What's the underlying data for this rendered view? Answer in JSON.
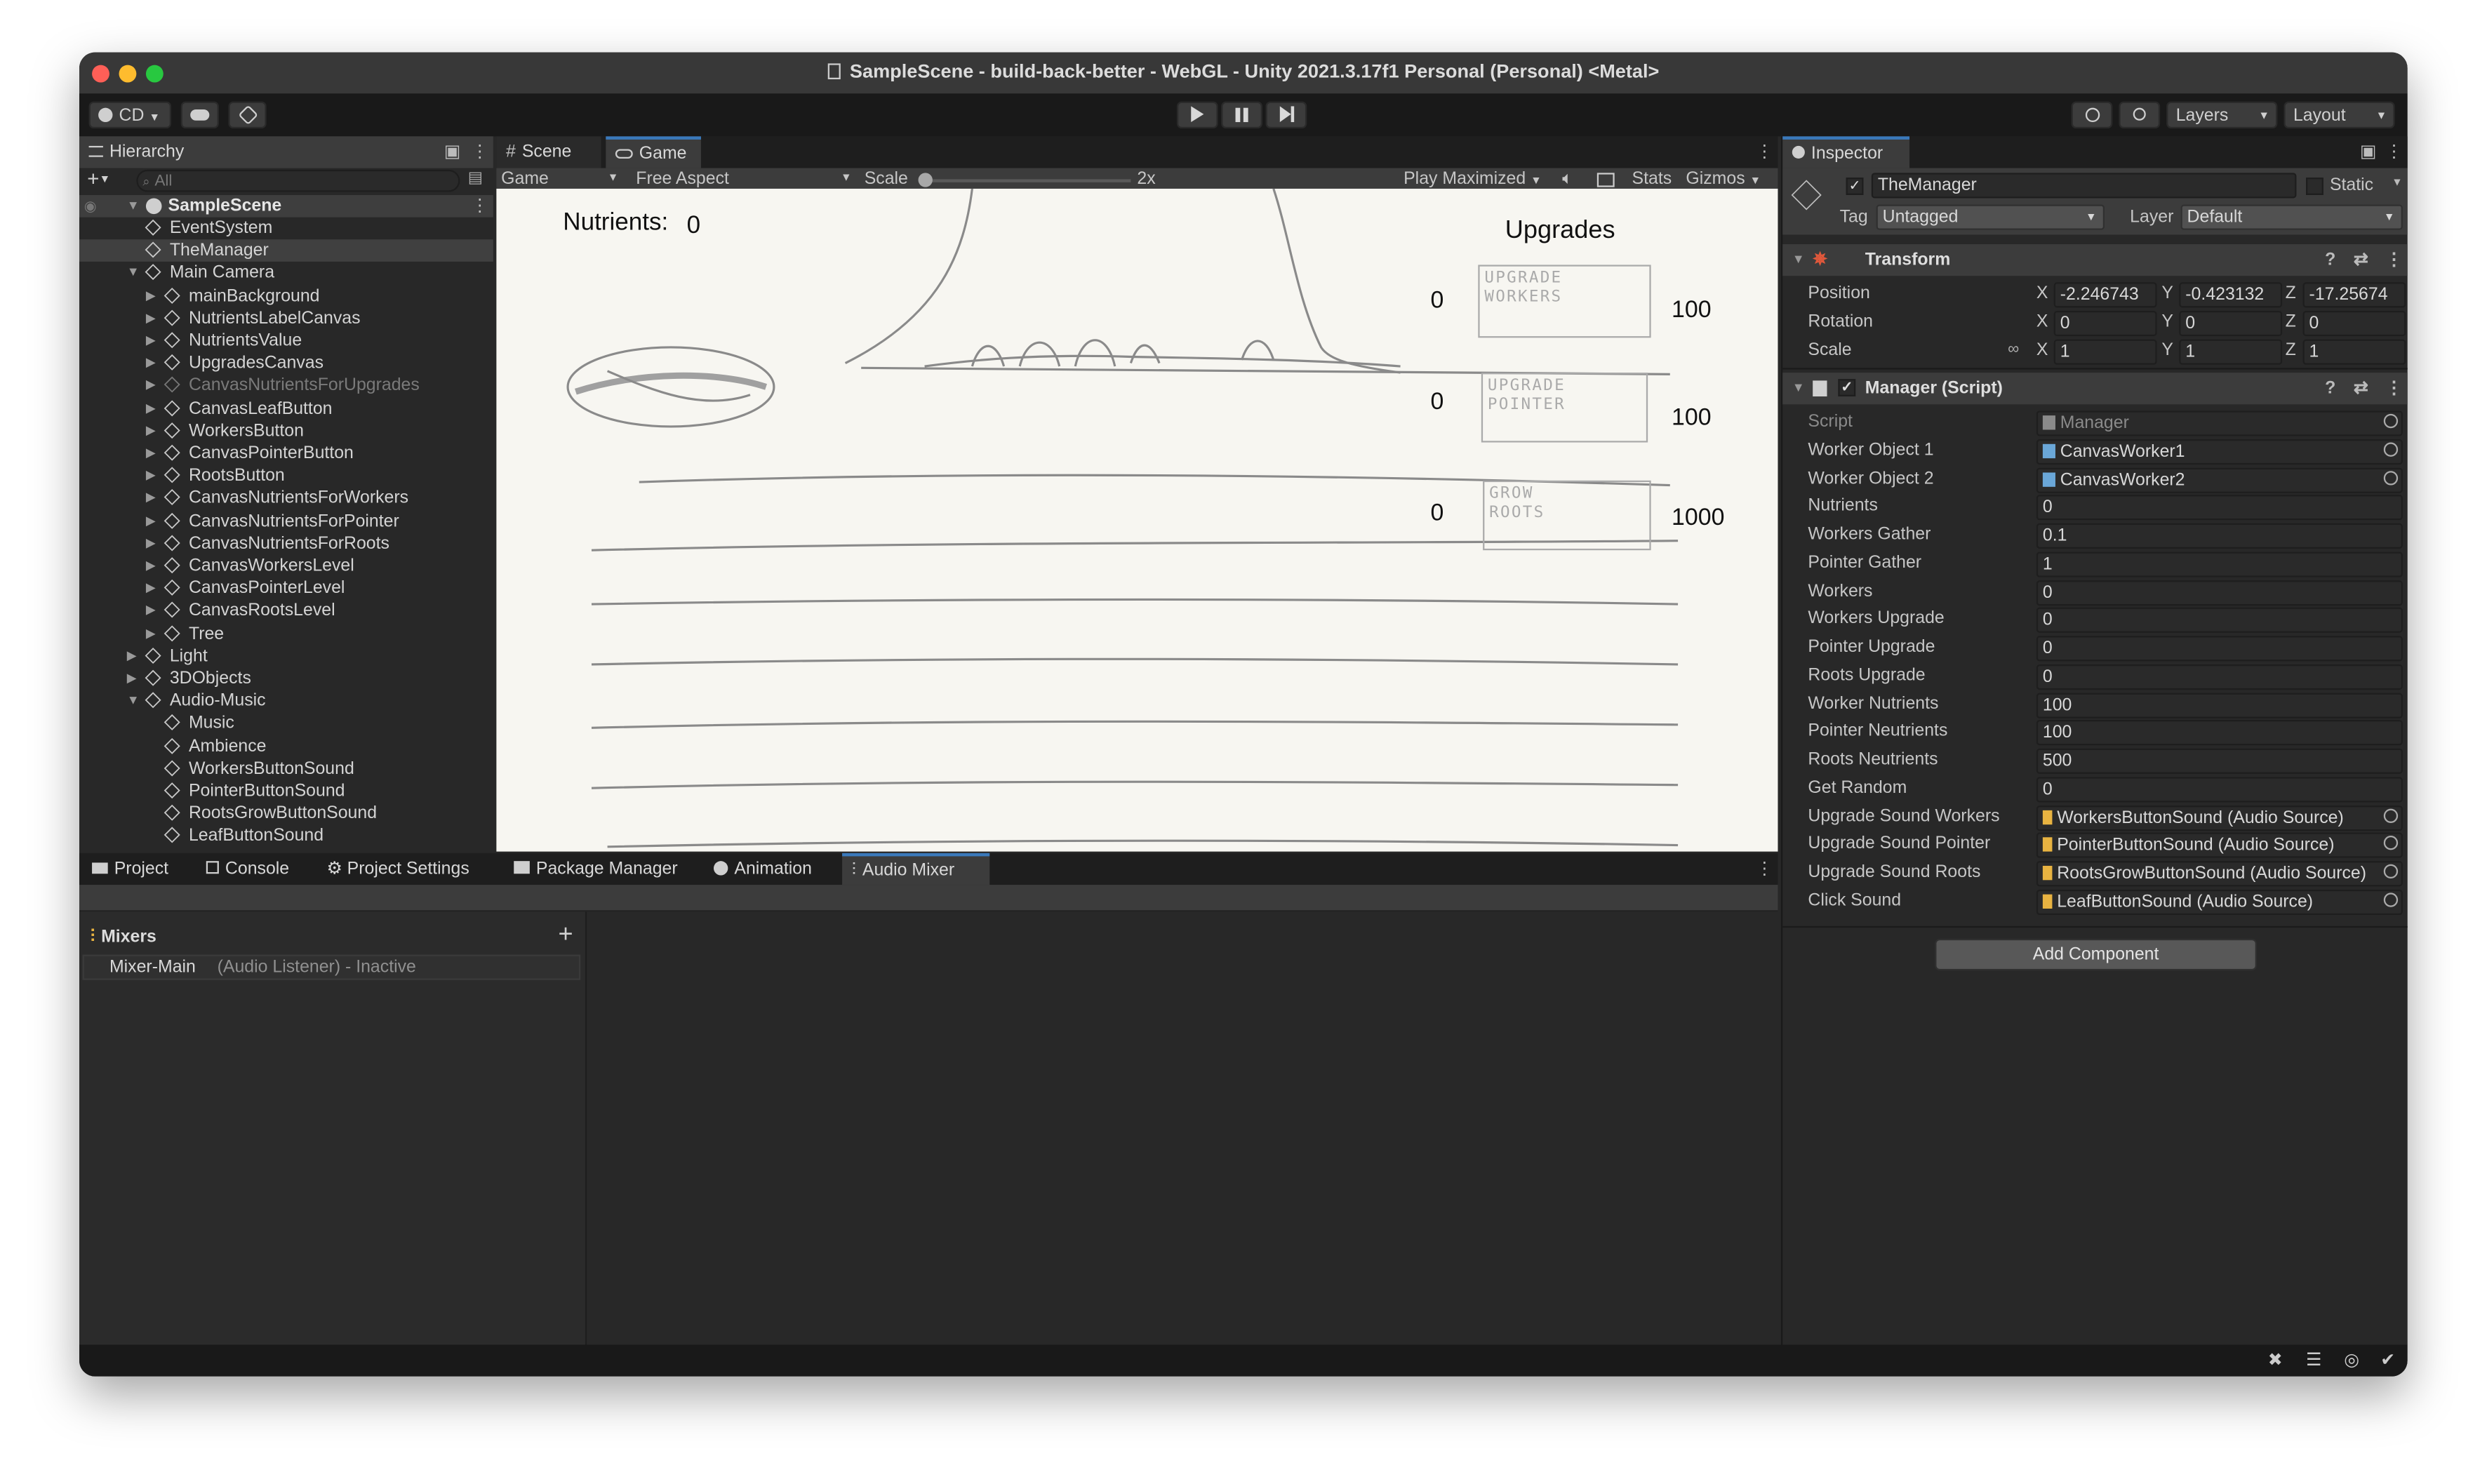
{
  "window": {
    "title": "SampleScene - build-back-better - WebGL - Unity 2021.3.17f1 Personal (Personal) <Metal>"
  },
  "toolbar": {
    "account": "CD",
    "layers": "Layers",
    "layout": "Layout"
  },
  "hierarchy": {
    "tab": "Hierarchy",
    "search_placeholder": "All",
    "scene": "SampleScene",
    "items": [
      {
        "label": "EventSystem",
        "depth": 1,
        "arrow": "",
        "dim": false,
        "selected": false
      },
      {
        "label": "TheManager",
        "depth": 1,
        "arrow": "",
        "dim": false,
        "selected": true
      },
      {
        "label": "Main Camera",
        "depth": 1,
        "arrow": "▼",
        "dim": false,
        "selected": false
      },
      {
        "label": "mainBackground",
        "depth": 2,
        "arrow": "▶",
        "dim": false,
        "selected": false
      },
      {
        "label": "NutrientsLabelCanvas",
        "depth": 2,
        "arrow": "▶",
        "dim": false,
        "selected": false
      },
      {
        "label": "NutrientsValue",
        "depth": 2,
        "arrow": "▶",
        "dim": false,
        "selected": false
      },
      {
        "label": "UpgradesCanvas",
        "depth": 2,
        "arrow": "▶",
        "dim": false,
        "selected": false
      },
      {
        "label": "CanvasNutrientsForUpgrades",
        "depth": 2,
        "arrow": "▶",
        "dim": true,
        "selected": false
      },
      {
        "label": "CanvasLeafButton",
        "depth": 2,
        "arrow": "▶",
        "dim": false,
        "selected": false
      },
      {
        "label": "WorkersButton",
        "depth": 2,
        "arrow": "▶",
        "dim": false,
        "selected": false
      },
      {
        "label": "CanvasPointerButton",
        "depth": 2,
        "arrow": "▶",
        "dim": false,
        "selected": false
      },
      {
        "label": "RootsButton",
        "depth": 2,
        "arrow": "▶",
        "dim": false,
        "selected": false
      },
      {
        "label": "CanvasNutrientsForWorkers",
        "depth": 2,
        "arrow": "▶",
        "dim": false,
        "selected": false
      },
      {
        "label": "CanvasNutrientsForPointer",
        "depth": 2,
        "arrow": "▶",
        "dim": false,
        "selected": false
      },
      {
        "label": "CanvasNutrientsForRoots",
        "depth": 2,
        "arrow": "▶",
        "dim": false,
        "selected": false
      },
      {
        "label": "CanvasWorkersLevel",
        "depth": 2,
        "arrow": "▶",
        "dim": false,
        "selected": false
      },
      {
        "label": "CanvasPointerLevel",
        "depth": 2,
        "arrow": "▶",
        "dim": false,
        "selected": false
      },
      {
        "label": "CanvasRootsLevel",
        "depth": 2,
        "arrow": "▶",
        "dim": false,
        "selected": false
      },
      {
        "label": "Tree",
        "depth": 2,
        "arrow": "▶",
        "dim": false,
        "selected": false
      },
      {
        "label": "Light",
        "depth": 1,
        "arrow": "▶",
        "dim": false,
        "selected": false
      },
      {
        "label": "3DObjects",
        "depth": 1,
        "arrow": "▶",
        "dim": false,
        "selected": false
      },
      {
        "label": "Audio-Music",
        "depth": 1,
        "arrow": "▼",
        "dim": false,
        "selected": false
      },
      {
        "label": "Music",
        "depth": 2,
        "arrow": "",
        "dim": false,
        "selected": false
      },
      {
        "label": "Ambience",
        "depth": 2,
        "arrow": "",
        "dim": false,
        "selected": false
      },
      {
        "label": "WorkersButtonSound",
        "depth": 2,
        "arrow": "",
        "dim": false,
        "selected": false
      },
      {
        "label": "PointerButtonSound",
        "depth": 2,
        "arrow": "",
        "dim": false,
        "selected": false
      },
      {
        "label": "RootsGrowButtonSound",
        "depth": 2,
        "arrow": "",
        "dim": false,
        "selected": false
      },
      {
        "label": "LeafButtonSound",
        "depth": 2,
        "arrow": "",
        "dim": false,
        "selected": false
      }
    ]
  },
  "center": {
    "tabs": [
      "Scene",
      "Game"
    ],
    "display": "Game",
    "aspect": "Free Aspect",
    "scale_label": "Scale",
    "scale_value": "2x",
    "play_maximized": "Play Maximized",
    "stats": "Stats",
    "gizmos": "Gizmos"
  },
  "game": {
    "nutrients_label": "Nutrients:",
    "nutrients_value": "0",
    "upgrades_title": "Upgrades",
    "upgrades": [
      {
        "level": "0",
        "sketch": "UPGRADE\nWORKERS",
        "cost": "100"
      },
      {
        "level": "0",
        "sketch": "UPGRADE\nPOINTER",
        "cost": "100"
      },
      {
        "level": "0",
        "sketch": "GROW\nROOTS",
        "cost": "1000"
      }
    ]
  },
  "bottom": {
    "tabs": [
      "Project",
      "Console",
      "Project Settings",
      "Package Manager",
      "Animation",
      "Audio Mixer"
    ],
    "mixers_title": "Mixers",
    "mixer_name": "Mixer-Main",
    "mixer_status": "(Audio Listener) - Inactive"
  },
  "inspector": {
    "tab": "Inspector",
    "object_name": "TheManager",
    "static_label": "Static",
    "tag_label": "Tag",
    "tag_value": "Untagged",
    "layer_label": "Layer",
    "layer_value": "Default",
    "transform": {
      "title": "Transform",
      "rows": [
        {
          "label": "Position",
          "x": "-2.246743",
          "y": "-0.423132 ",
          "z": "-17.25674"
        },
        {
          "label": "Rotation",
          "x": "0",
          "y": "0",
          "z": "0"
        },
        {
          "label": "Scale",
          "x": "1",
          "y": "1",
          "z": "1"
        }
      ]
    },
    "script": {
      "title": "Manager (Script)",
      "fields": [
        {
          "label": "Script",
          "value": "Manager",
          "kind": "script"
        },
        {
          "label": "Worker Object 1",
          "value": "CanvasWorker1",
          "kind": "object"
        },
        {
          "label": "Worker Object 2",
          "value": "CanvasWorker2",
          "kind": "object"
        },
        {
          "label": "Nutrients",
          "value": "0",
          "kind": "value"
        },
        {
          "label": "Workers Gather",
          "value": "0.1",
          "kind": "value"
        },
        {
          "label": "Pointer Gather",
          "value": "1",
          "kind": "value"
        },
        {
          "label": "Workers",
          "value": "0",
          "kind": "value"
        },
        {
          "label": "Workers Upgrade",
          "value": "0",
          "kind": "value"
        },
        {
          "label": "Pointer Upgrade",
          "value": "0",
          "kind": "value"
        },
        {
          "label": "Roots Upgrade",
          "value": "0",
          "kind": "value"
        },
        {
          "label": "Worker Nutrients",
          "value": "100",
          "kind": "value"
        },
        {
          "label": "Pointer Neutrients",
          "value": "100",
          "kind": "value"
        },
        {
          "label": "Roots Neutrients",
          "value": "500",
          "kind": "value"
        },
        {
          "label": "Get Random",
          "value": "0",
          "kind": "value"
        },
        {
          "label": "Upgrade Sound Workers",
          "value": "WorkersButtonSound (Audio Source)",
          "kind": "audio"
        },
        {
          "label": "Upgrade Sound Pointer",
          "value": "PointerButtonSound (Audio Source)",
          "kind": "audio"
        },
        {
          "label": "Upgrade Sound Roots",
          "value": "RootsGrowButtonSound (Audio Source)",
          "kind": "audio"
        },
        {
          "label": "Click Sound",
          "value": "LeafButtonSound (Audio Source)",
          "kind": "audio"
        }
      ]
    },
    "add_component": "Add Component"
  },
  "colors": {
    "accent": "#3a79bb",
    "selected_row": "#2c5d87",
    "game_bg": "#f7f6f1",
    "panel": "#282828",
    "header": "#3c3c3c"
  }
}
